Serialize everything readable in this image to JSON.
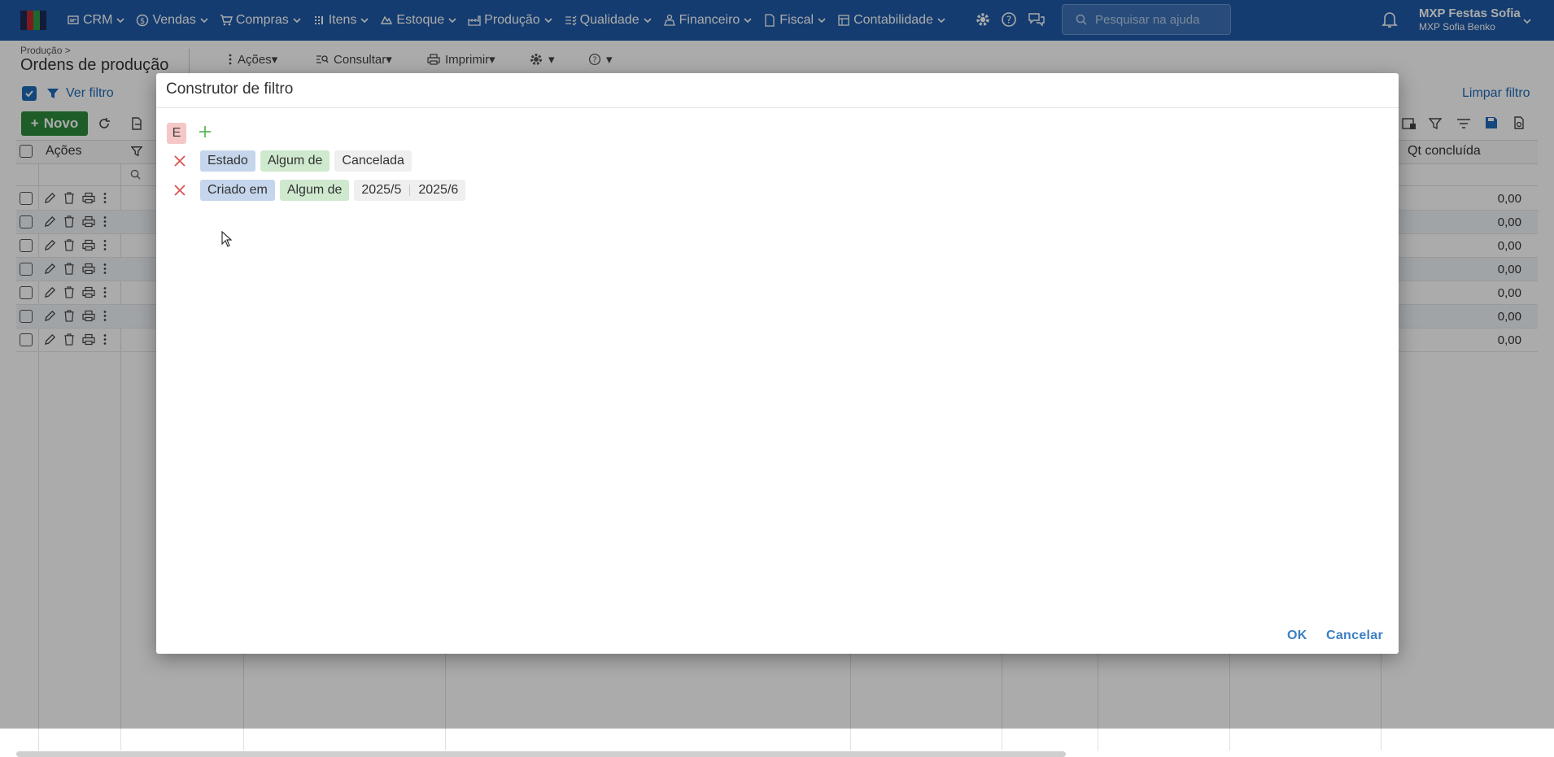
{
  "topbar": {
    "nav": [
      {
        "label": "CRM",
        "icon": "crm-icon"
      },
      {
        "label": "Vendas",
        "icon": "dollar-icon"
      },
      {
        "label": "Compras",
        "icon": "cart-icon"
      },
      {
        "label": "Itens",
        "icon": "items-icon"
      },
      {
        "label": "Estoque",
        "icon": "stock-icon"
      },
      {
        "label": "Produção",
        "icon": "factory-icon"
      },
      {
        "label": "Qualidade",
        "icon": "quality-icon"
      },
      {
        "label": "Financeiro",
        "icon": "finance-icon"
      },
      {
        "label": "Fiscal",
        "icon": "fiscal-icon"
      },
      {
        "label": "Contabilidade",
        "icon": "accounting-icon"
      }
    ],
    "search_placeholder": "Pesquisar na ajuda",
    "user_company": "MXP Festas Sofia",
    "user_name": "MXP Sofia Benko",
    "brand_color": "#1e5aa8"
  },
  "page": {
    "breadcrumb": "Produção >",
    "title": "Ordens de produção",
    "toolbar": {
      "acoes": "Ações",
      "consultar": "Consultar",
      "imprimir": "Imprimir"
    },
    "ver_filtro": "Ver filtro",
    "limpar_filtro": "Limpar filtro",
    "novo": "Novo",
    "columns": {
      "acoes": "Ações",
      "qt_concluida": "Qt concluída"
    },
    "rows": [
      {
        "qt": "0,00"
      },
      {
        "qt": "0,00"
      },
      {
        "qt": "0,00"
      },
      {
        "qt": "0,00"
      },
      {
        "qt": "0,00"
      },
      {
        "qt": "0,00"
      },
      {
        "qt": "0,00"
      }
    ]
  },
  "modal": {
    "title": "Construtor de filtro",
    "group_operator": "E",
    "conditions": [
      {
        "field": "Estado",
        "operator": "Algum de",
        "values": [
          "Cancelada"
        ]
      },
      {
        "field": "Criado em",
        "operator": "Algum de",
        "values": [
          "2025/5",
          "2025/6"
        ]
      }
    ],
    "ok": "OK",
    "cancel": "Cancelar"
  }
}
